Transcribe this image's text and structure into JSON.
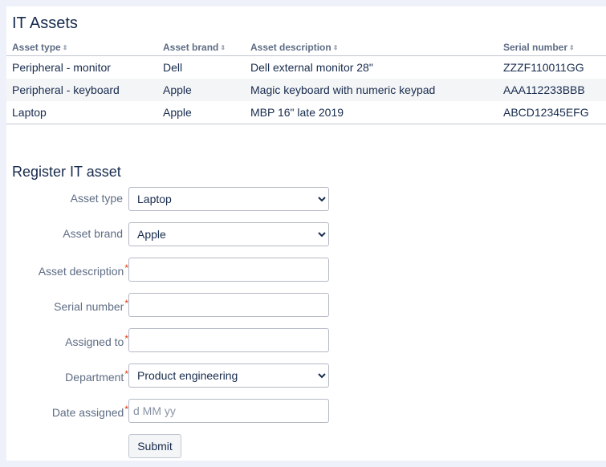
{
  "assets": {
    "title": "IT Assets",
    "columns": [
      "Asset type",
      "Asset brand",
      "Asset description",
      "Serial number"
    ],
    "rows": [
      [
        "Peripheral - monitor",
        "Dell",
        "Dell external monitor 28\"",
        "ZZZF110011GG"
      ],
      [
        "Peripheral - keyboard",
        "Apple",
        "Magic keyboard with numeric keypad",
        "AAA112233BBB"
      ],
      [
        "Laptop",
        "Apple",
        "MBP 16\" late 2019",
        "ABCD12345EFG"
      ]
    ]
  },
  "form": {
    "title": "Register IT asset",
    "asset_type": {
      "label": "Asset type",
      "value": "Laptop"
    },
    "asset_brand": {
      "label": "Asset brand",
      "value": "Apple"
    },
    "asset_description": {
      "label": "Asset description",
      "value": ""
    },
    "serial_number": {
      "label": "Serial number",
      "value": ""
    },
    "assigned_to": {
      "label": "Assigned to",
      "value": ""
    },
    "department": {
      "label": "Department",
      "value": "Product engineering"
    },
    "date_assigned": {
      "label": "Date assigned",
      "placeholder": "d MM yy",
      "value": ""
    },
    "required_mark": "*",
    "submit_label": "Submit"
  }
}
